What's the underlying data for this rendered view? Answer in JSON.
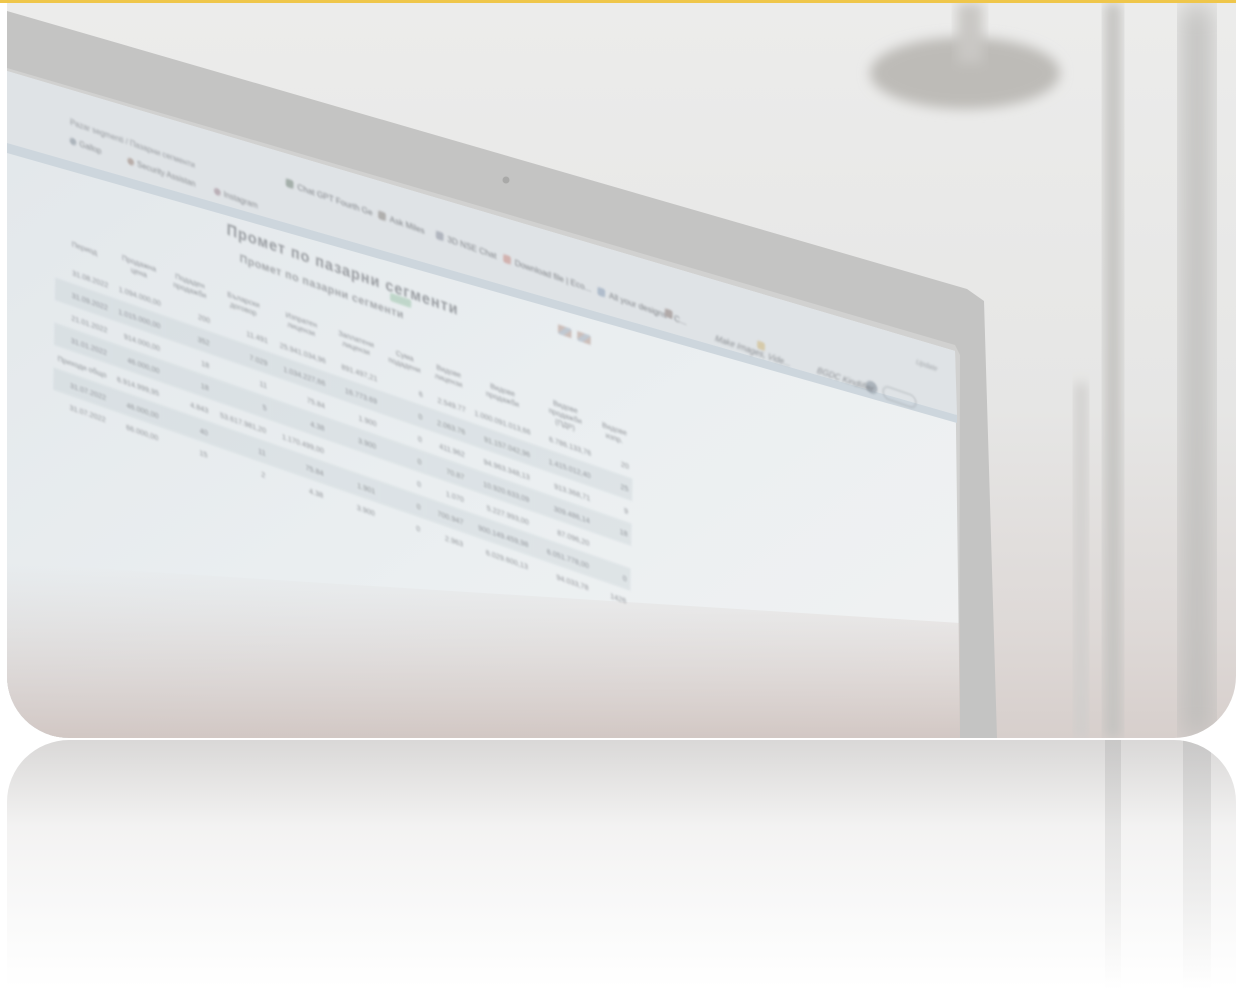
{
  "scene": {
    "accent_line_color": "#efc64a",
    "monitor_bezel_color": "#c4c4c3",
    "screen_tint": "#e7edf0",
    "wall_color": "#ebebea",
    "lamp_color": "#bcbab6"
  },
  "browser": {
    "tabs": [
      {
        "label": "Chat GPT Fourth Ge",
        "icon": "openai-icon",
        "color": "#9aa6a0"
      },
      {
        "label": "Ask Miles",
        "icon": "rocket-icon",
        "color": "#a8a6a4"
      },
      {
        "label": "3D NSE Chat",
        "icon": "document-icon",
        "color": "#a9aeb8"
      },
      {
        "label": "Download file | Eco...",
        "icon": "arrow-icon",
        "color": "#d0aaa6"
      },
      {
        "label": "All your designs - C...",
        "icon": "globe-icon",
        "color": "#a8b6c7"
      },
      {
        "label": "Make Images, Vide...",
        "icon": "square-icon",
        "color": "#a69c9a"
      },
      {
        "label": "BGDC Kindlifier",
        "icon": "bookmark-icon",
        "color": "#d4c49c"
      }
    ],
    "address": "Pazar segmenti / Пазарни сегменти",
    "bookmarks": [
      {
        "label": "Gallop",
        "color": "#a4acb4"
      },
      {
        "label": "Security Assistan",
        "color": "#b2a49f"
      },
      {
        "label": "Instagram",
        "color": "#b4a6ae"
      }
    ],
    "profile_button": "Update"
  },
  "page": {
    "title": "Промет по пазарни сегменти",
    "subtitle": "Промет по пазарни сегменти",
    "table": {
      "headers": [
        "Договор",
        "Период",
        "Продажна цена",
        "Подаден продажби",
        "Бъларски договор",
        "Изпратен лицензи",
        "Заплатени лицензи",
        "Сума подадени",
        "Видове лицензи",
        "Видове продажби",
        "Видове продажби (ПДР)",
        "Видове изпр."
      ],
      "rows": [
        [
          "31.08.2022",
          "1.094.000,00",
          "200",
          "11.491",
          "25.941.034,96",
          "891.497,21",
          "6",
          "2.549.77",
          "1.000.091.013,66",
          "6.786.133,76",
          "20"
        ],
        [
          "31.09.2022",
          "1.015.000,00",
          "352",
          "7.029",
          "1.034.227,66",
          "16.773.69",
          "0",
          "2.063.76",
          "91.157.042,96",
          "1.415.012,40",
          "25"
        ],
        [
          "21.01.2022",
          "914.000,00",
          "18",
          "11",
          "75.84",
          "1.900",
          "0",
          "411.962",
          "94.963.348,13",
          "913.368,71",
          "9"
        ],
        [
          "31.01.2022",
          "46.000,00",
          "18",
          "5",
          "4.38",
          "3.900",
          "0",
          "70.87",
          "10.920.633,09",
          "309.486,14",
          "18"
        ],
        [
          "Приходи общо",
          "6.914.999,95",
          "4.843",
          "53.617.981,20",
          "1.170.499,00",
          "",
          "0",
          "1.070",
          "5.227.993,00",
          "87.096,20",
          ""
        ],
        [
          "31.07.2022",
          "46.000,00",
          "40",
          "11",
          "75.84",
          "1.901",
          "0",
          "700.947",
          "900.149.459,98",
          "6.051.778,00",
          "0"
        ],
        [
          "31.07.2022",
          "66.000,00",
          "15",
          "2",
          "4.38",
          "3.900",
          "0",
          "2.963",
          "6.029.600,13",
          "94.033,78",
          "1426"
        ]
      ]
    }
  }
}
